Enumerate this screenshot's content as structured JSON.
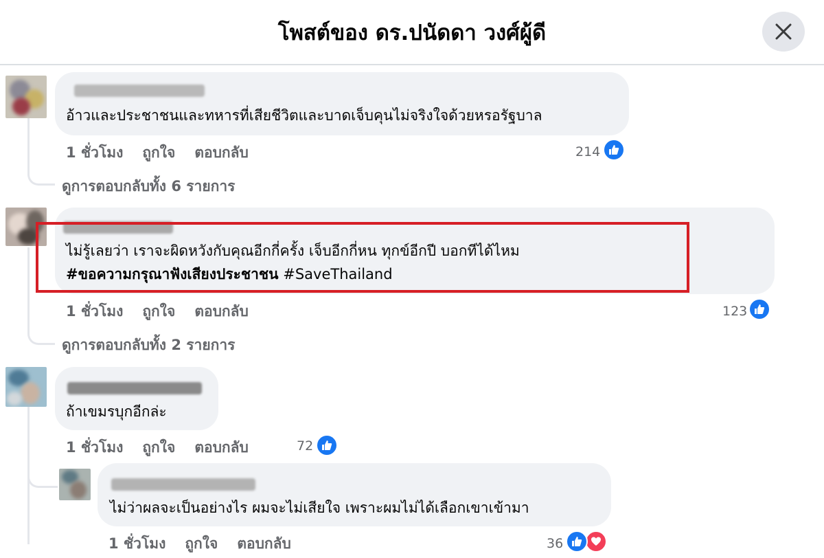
{
  "header": {
    "title": "โพสต์ของ ดร.ปนัดดา วงศ์ผู้ดี",
    "close_icon": "close-icon"
  },
  "comments": [
    {
      "text_lines": [
        "อ้าวและประชาชนและทหารที่เสียชีวิตและบาดเจ็บคุนไม่จริงใจด้วยหรอรัฐบาล"
      ],
      "time": "1 ชั่วโมง",
      "like_label": "ถูกใจ",
      "reply_label": "ตอบกลับ",
      "reaction_count": "214",
      "reactions": [
        "like-icon"
      ],
      "view_replies": "ดูการตอบกลับทั้ง 6 รายการ"
    },
    {
      "text_line1": "ไม่รู้เลยว่า เราจะผิดหวังกับคุณอีกกี่ครั้ง เจ็บอีกกี่หน ทุกข์อีกปี บอกทีได้ไหม",
      "text_line2_hashtag1": "#ขอความกรุณาฟังเสียงประชาชน",
      "text_line2_hashtag2": "#SaveThailand",
      "time": "1 ชั่วโมง",
      "like_label": "ถูกใจ",
      "reply_label": "ตอบกลับ",
      "reaction_count": "123",
      "reactions": [
        "like-icon"
      ],
      "view_replies": "ดูการตอบกลับทั้ง 2 รายการ",
      "highlight_color": "#d61f26"
    },
    {
      "text_lines": [
        "ถ้าเขมรบุกอีกล่ะ"
      ],
      "time": "1 ชั่วโมง",
      "like_label": "ถูกใจ",
      "reply_label": "ตอบกลับ",
      "reaction_count": "72",
      "reactions": [
        "like-icon"
      ]
    }
  ],
  "reply": {
    "text_lines": [
      "ไม่ว่าผลจะเป็นอย่างไร ผมจะไม่เสียใจ เพราะผมไม่ได้เลือกเขาเข้ามา"
    ],
    "time": "1 ชั่วโมง",
    "like_label": "ถูกใจ",
    "reply_label": "ตอบกลับ",
    "reaction_count": "36",
    "reactions": [
      "like-icon",
      "love-icon"
    ]
  },
  "colors": {
    "bubble": "#f0f2f5",
    "secondary_text": "#65676b",
    "like_blue": "#1877f2",
    "love_red": "#f33e58"
  }
}
